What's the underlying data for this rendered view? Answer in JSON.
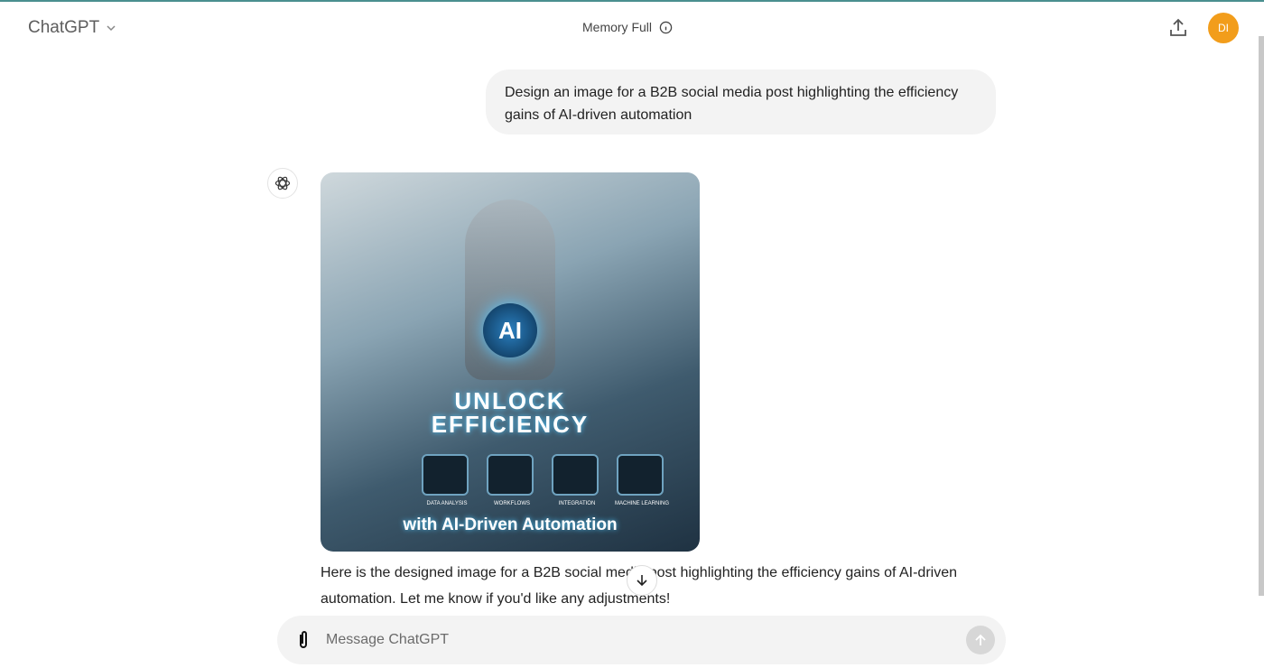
{
  "header": {
    "title": "ChatGPT",
    "memory_status": "Memory Full",
    "avatar_initials": "DI",
    "avatar_color": "#f29d1b"
  },
  "conversation": {
    "user_message": "Design an image for a B2B social media post highlighting the efficiency gains of AI-driven automation",
    "image": {
      "lettering": {
        "badge": "AI",
        "headline": "UNLOCK EFFICIENCY",
        "subline": "with AI-Driven Automation",
        "tiles": [
          "DATA ANALYSIS",
          "WORKFLOWS",
          "INTEGRATION",
          "MACHINE LEARNING"
        ]
      }
    },
    "assistant_message": "Here is the designed image for a B2B social media post highlighting the efficiency gains of AI-driven automation. Let me know if you'd like any adjustments!"
  },
  "composer": {
    "placeholder": "Message ChatGPT"
  },
  "icons": {
    "model": "chevron-down-icon",
    "info": "info-icon",
    "share": "share-icon",
    "assistant": "openai-logo-icon",
    "scroll": "arrow-down-icon",
    "attach": "paperclip-icon",
    "send": "arrow-up-icon"
  }
}
